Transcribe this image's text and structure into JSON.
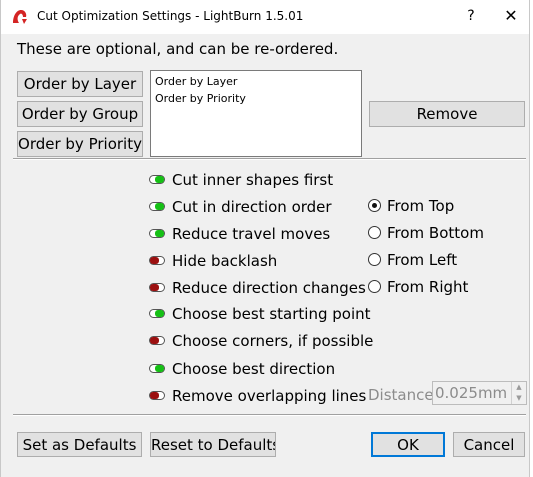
{
  "window": {
    "title": "Cut Optimization Settings - LightBurn 1.5.01",
    "help_glyph": "?",
    "close_glyph": "✕",
    "app_icon": "lightburn-logo-icon"
  },
  "hint": "These are optional, and can be re-ordered.",
  "order_buttons": {
    "layer": "Order by Layer",
    "group": "Order by Group",
    "priority": "Order by Priority"
  },
  "order_list": [
    "Order by Layer",
    "Order by Priority"
  ],
  "remove_label": "Remove",
  "options": [
    {
      "label": "Cut inner shapes first",
      "enabled": true
    },
    {
      "label": "Cut in direction order",
      "enabled": true
    },
    {
      "label": "Reduce travel moves",
      "enabled": true
    },
    {
      "label": "Hide backlash",
      "enabled": false
    },
    {
      "label": "Reduce direction changes",
      "enabled": false
    },
    {
      "label": "Choose best starting point",
      "enabled": true
    },
    {
      "label": "Choose corners, if possible",
      "enabled": false
    },
    {
      "label": "Choose best direction",
      "enabled": true
    },
    {
      "label": "Remove overlapping lines",
      "enabled": false
    }
  ],
  "direction": {
    "options": [
      "From Top",
      "From Bottom",
      "From Left",
      "From Right"
    ],
    "selected": "From Top"
  },
  "distance": {
    "label": "Distance:",
    "value": "0.025mm",
    "enabled": false
  },
  "footer": {
    "set_defaults": "Set as Defaults",
    "reset_defaults": "Reset to Defaults",
    "ok": "OK",
    "cancel": "Cancel"
  },
  "colors": {
    "toggle_on": "#15c015",
    "toggle_off": "#9c1010",
    "default_button_border": "#0078d7"
  }
}
